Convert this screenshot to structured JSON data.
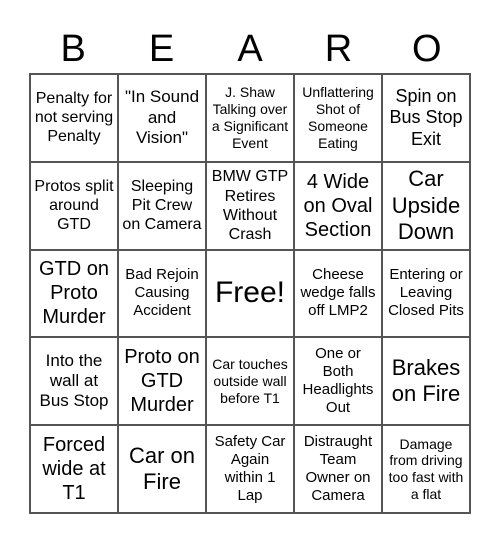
{
  "header": [
    "B",
    "E",
    "A",
    "R",
    "O"
  ],
  "cells": [
    "Penalty for not serving Penalty",
    "\"In Sound and Vision\"",
    "J. Shaw Talking over a Significant Event",
    "Unflattering Shot of Someone Eating",
    "Spin on Bus Stop Exit",
    "Protos split around GTD",
    "Sleeping Pit Crew on Camera",
    "BMW GTP Retires Without Crash",
    "4 Wide on Oval Section",
    "Car Upside Down",
    "GTD on Proto Murder",
    "Bad Rejoin Causing Accident",
    "Free!",
    "Cheese wedge falls off LMP2",
    "Entering or Leaving Closed Pits",
    "Into the wall at Bus Stop",
    "Proto on GTD Murder",
    "Car touches outside wall before T1",
    "One or Both Headlights Out",
    "Brakes on Fire",
    "Forced wide at T1",
    "Car on Fire",
    "Safety Car Again within 1 Lap",
    "Distraught Team Owner on Camera",
    "Damage from driving too fast with a flat"
  ]
}
